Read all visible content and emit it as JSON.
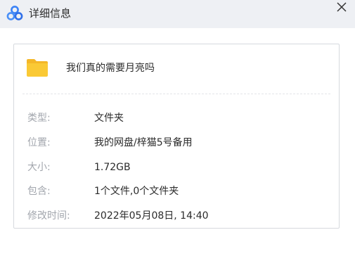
{
  "window": {
    "title": "详细信息",
    "close_glyph": "×"
  },
  "file": {
    "name": "我们真的需要月亮吗",
    "icon": "folder-icon",
    "icon_color": "#F9C636"
  },
  "details": {
    "type_label": "类型:",
    "type_value": "文件夹",
    "location_label": "位置:",
    "location_value": "我的网盘/梓猫5号备用",
    "size_label": "大小:",
    "size_value": "1.72GB",
    "contains_label": "包含:",
    "contains_value": "1个文件,0个文件夹",
    "modified_label": "修改时间:",
    "modified_value": "2022年05月08日, 14:40"
  },
  "colors": {
    "titlebar_bg": "#EEF0F4",
    "label_text": "#A2A6AD",
    "value_text": "#2B2B2B",
    "logo_blue": "#3B82F6"
  }
}
